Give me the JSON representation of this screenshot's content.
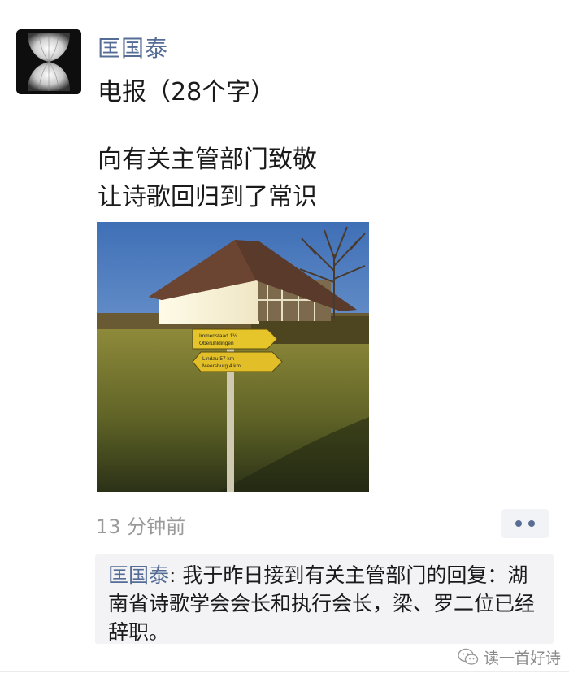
{
  "post": {
    "author": "匡国泰",
    "line1": "电报（28个字）",
    "body_line1": "向有关主管部门致敬",
    "body_line2": "让诗歌回归到了常识",
    "photo_sign_top": "Immenstaad 1½\nOberuhldingen",
    "photo_sign_bottom": "Lindau 57 km\nMeersburg 4 km",
    "timestamp": "13 分钟前",
    "more_icon": "ellipsis-icon"
  },
  "comment": {
    "author": "匡国泰",
    "separator": ": ",
    "text": "我于昨日接到有关主管部门的回复：湖南省诗歌学会会长和执行会长，梁、罗二位已经辞职。"
  },
  "watermark": {
    "text": "读一首好诗",
    "icon": "wechat-icon"
  },
  "colors": {
    "link_blue": "#556c96",
    "timestamp_gray": "#9a9a9a",
    "comment_bg": "#f3f3f5"
  }
}
